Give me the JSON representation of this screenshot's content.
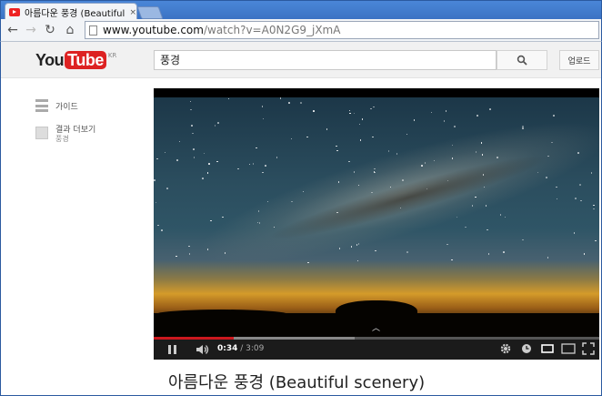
{
  "browser": {
    "tab_title": "아름다운 풍경 (Beautiful",
    "tab_close": "×",
    "url_host": "www.youtube.com",
    "url_path": "/watch?v=A0N2G9_jXmA",
    "back_glyph": "←",
    "forward_glyph": "→",
    "reload_glyph": "↻",
    "home_glyph": "⌂"
  },
  "masthead": {
    "logo_you": "You",
    "logo_tube": "Tube",
    "region": "KR",
    "search_value": "풍경",
    "upload_label": "업로드"
  },
  "sidebar": {
    "guide_label": "가이드",
    "more_results_label": "결과 더보기",
    "more_results_sub": "풍경"
  },
  "player": {
    "current_time": "0:34",
    "separator": " / ",
    "duration": "3:09",
    "played_fraction": 0.18,
    "loaded_fraction": 0.45,
    "expand_glyph": "︿"
  },
  "video": {
    "title": "아름다운 풍경 (Beautiful scenery)"
  },
  "colors": {
    "brand_red": "#cc181e",
    "chrome_blue": "#3b73c4"
  },
  "icons": [
    "youtube-favicon",
    "back-icon",
    "forward-icon",
    "reload-icon",
    "home-icon",
    "page-icon",
    "search-icon",
    "guide-icon",
    "more-results-icon",
    "pause-icon",
    "volume-icon",
    "settings-icon",
    "watch-later-icon",
    "small-player-icon",
    "large-player-icon",
    "fullscreen-icon"
  ]
}
